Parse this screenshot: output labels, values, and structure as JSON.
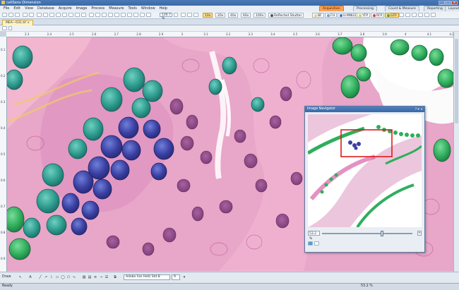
{
  "app": {
    "title": "cellSens Dimension",
    "window_buttons": {
      "minimize": "_",
      "maximize": "□",
      "close": "×"
    }
  },
  "menu": [
    "File",
    "Edit",
    "View",
    "Database",
    "Acquire",
    "Image",
    "Process",
    "Measure",
    "Tools",
    "Window",
    "Help"
  ],
  "workspace_tabs": [
    "Acquisition",
    "Processing",
    "Count & Measure",
    "Reporting",
    "Layout"
  ],
  "toolbar": {
    "zoom_value": "126.7 %",
    "objectives": [
      "10x",
      "20x",
      "40x",
      "60x",
      "100x"
    ],
    "selected_objective": "10x",
    "reflected_shutter_label": "Reflected Shutter",
    "filter_buttons": [
      "BF",
      "FH",
      "U-MNU2",
      "YFP",
      "RFP",
      "GFP"
    ],
    "filter_colors": [
      "#f3d36b",
      "#7a9fd6",
      "#3a7ad0",
      "#d6d04a",
      "#d04a4a",
      "#4ab04a"
    ]
  },
  "document_tab": {
    "label": "MEA—031.tif",
    "close": "×"
  },
  "ruler": {
    "x_ticks": [
      "2.3",
      "2.4",
      "2.5",
      "2.6",
      "2.7",
      "2.8",
      "2.9",
      "3",
      "3.1",
      "3.2",
      "3.3",
      "3.4",
      "3.5",
      "3.6",
      "3.7",
      "3.8",
      "3.9",
      "4",
      "4.1",
      "4.2"
    ],
    "y_ticks": [
      "0.1",
      "0.2",
      "0.3",
      "0.4",
      "0.5",
      "0.6",
      "0.7",
      "0.8",
      "0.9"
    ]
  },
  "navigator": {
    "title": "Image Navigator",
    "header_buttons": "? ▾ ×",
    "zoom_value": "53.2 %",
    "slider_value_percent": 53.2
  },
  "drawbar": {
    "label": "Draw",
    "font_name": "Adobe Fan Heiti Std B",
    "font_size": "9"
  },
  "status": {
    "zoom": "53.2 %",
    "ready": "Ready"
  },
  "icons": {
    "app": "app-icon",
    "navigator_fit": "fit-icon",
    "navigator_expand": "expand-icon"
  }
}
